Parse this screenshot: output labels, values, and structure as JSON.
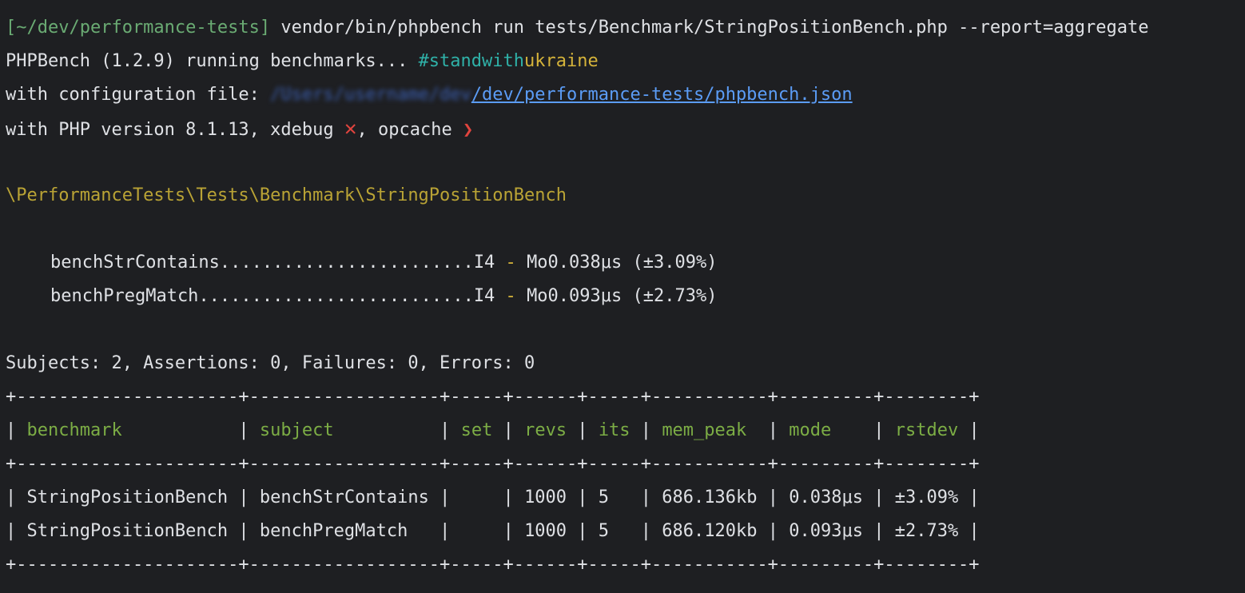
{
  "prompt": {
    "path": "[~/dev/performance-tests]",
    "command": "vendor/bin/phpbench run tests/Benchmark/StringPositionBench.php --report=aggregate"
  },
  "banner": {
    "running": "PHPBench (1.2.9) running benchmarks... ",
    "hashtag_a": "#standwith",
    "hashtag_b": "ukraine"
  },
  "config": {
    "label": "with configuration file: ",
    "blurred_path": "/Users/username/dev",
    "path": "/dev/performance-tests/phpbench.json"
  },
  "php": {
    "label": "with PHP version 8.1.13, xdebug ",
    "xdebug_mark": "✕",
    "opcache_label": ", opcache ",
    "opcache_mark": "❯"
  },
  "bench_class": "\\PerformanceTests\\Tests\\Benchmark\\StringPositionBench",
  "progress": [
    {
      "name": "benchStrContains",
      "dots": "........................",
      "iter": "I4",
      "sep": " - ",
      "result": "Mo0.038μs (±3.09%)"
    },
    {
      "name": "benchPregMatch",
      "dots": "..........................",
      "iter": "I4",
      "sep": " - ",
      "result": "Mo0.093μs (±2.73%)"
    }
  ],
  "summary": "Subjects: 2, Assertions: 0, Failures: 0, Errors: 0",
  "table": {
    "border": "+---------------------+------------------+-----+------+-----+-----------+---------+--------+",
    "headers": [
      "benchmark",
      "subject",
      "set",
      "revs",
      "its",
      "mem_peak",
      "mode",
      "rstdev"
    ],
    "rows": [
      [
        "StringPositionBench",
        "benchStrContains",
        "",
        "1000",
        "5",
        "686.136kb",
        "0.038μs",
        "±3.09%"
      ],
      [
        "StringPositionBench",
        "benchPregMatch",
        "",
        "1000",
        "5",
        "686.120kb",
        "0.093μs",
        "±2.73%"
      ]
    ]
  },
  "colors": {
    "background": "#1e1f22",
    "text": "#dfe1e5",
    "path_green": "#6aab73",
    "hashtag_teal": "#2fb1a8",
    "hashtag_yellow": "#d5b33a",
    "class_olive": "#b9a335",
    "link_blue": "#5b9cf6",
    "header_green": "#7cad45",
    "mark_red": "#e0443e"
  }
}
